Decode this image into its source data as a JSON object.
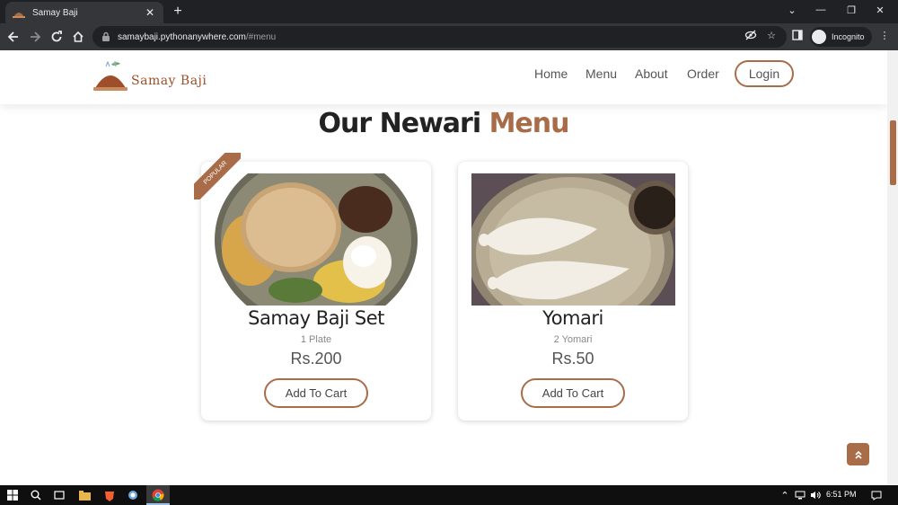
{
  "browser": {
    "tab_title": "Samay Baji",
    "tab_close": "✕",
    "new_tab": "+",
    "url_host": "samaybaji.pythonanywhere.com",
    "url_path": "/#menu",
    "incognito_label": "Incognito",
    "window_controls": [
      "⌄",
      "—",
      "❐",
      "✕"
    ]
  },
  "site": {
    "brand": "Samay Baji",
    "nav": [
      "Home",
      "Menu",
      "About",
      "Order"
    ],
    "login": "Login"
  },
  "section": {
    "title_main": "Our Newari",
    "title_accent": "Menu"
  },
  "menu_items": [
    {
      "name": "Samay Baji Set",
      "qty": "1 Plate",
      "price": "Rs.200",
      "button": "Add To Cart",
      "badge": "POPULAR"
    },
    {
      "name": "Yomari",
      "qty": "2 Yomari",
      "price": "Rs.50",
      "button": "Add To Cart"
    }
  ],
  "taskbar": {
    "time": "6:51 PM"
  },
  "colors": {
    "accent": "#a86d48",
    "chrome_dark": "#202124",
    "chrome_toolbar": "#35363a"
  }
}
